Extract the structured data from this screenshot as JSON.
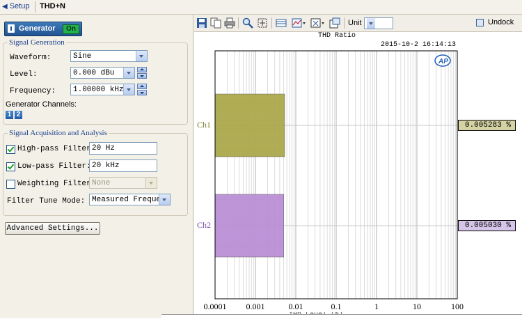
{
  "nav": {
    "back_label": "Setup",
    "page_title": "THD+N"
  },
  "generator": {
    "button_label": "Generator",
    "on_label": "On",
    "group_title": "Signal Generation",
    "waveform_label": "Waveform:",
    "waveform_value": "Sine",
    "level_label": "Level:",
    "level_value": "0.000 dBu",
    "frequency_label": "Frequency:",
    "frequency_value": "1.00000 kHz",
    "channels_label": "Generator Channels:",
    "channels": [
      "1",
      "2"
    ]
  },
  "acquisition": {
    "group_title": "Signal Acquisition and Analysis",
    "highpass_label": "High-pass Filter:",
    "highpass_checked": true,
    "highpass_value": "20 Hz",
    "lowpass_label": "Low-pass Filter:",
    "lowpass_checked": true,
    "lowpass_value": "20 kHz",
    "weighting_label": "Weighting Filter:",
    "weighting_checked": false,
    "weighting_value": "None",
    "tune_label": "Filter Tune Mode:",
    "tune_value": "Measured Frequenc",
    "advanced_button": "Advanced Settings..."
  },
  "toolbar": {
    "icons": [
      "save-icon",
      "copy-icon",
      "print-icon",
      "zoom-icon",
      "fit-icon",
      "table-icon",
      "graph-icon",
      "axis-icon",
      "settings-icon"
    ],
    "unit_label": "Unit",
    "unit_value": "%",
    "undock_label": "Undock"
  },
  "chart": {
    "title": "THD Ratio",
    "timestamp": "2015-10-2 16:14:13",
    "logo": "AP",
    "channels": [
      {
        "label": "Ch1",
        "readout": "0.005283 %"
      },
      {
        "label": "Ch2",
        "readout": "0.005030 %"
      }
    ],
    "x_ticks": [
      "0.0001",
      "0.001",
      "0.01",
      "0.1",
      "1",
      "10",
      "100"
    ],
    "x_label": "THD Level (%)"
  },
  "chart_data": {
    "type": "bar",
    "orientation": "horizontal",
    "title": "THD Ratio",
    "categories": [
      "Ch1",
      "Ch2"
    ],
    "values": [
      0.005283,
      0.00503
    ],
    "colors": [
      "#aaa749",
      "#b98ed5"
    ],
    "xlabel": "THD Level (%)",
    "x_scale": "log",
    "xlim": [
      0.0001,
      100
    ],
    "grid": true
  }
}
